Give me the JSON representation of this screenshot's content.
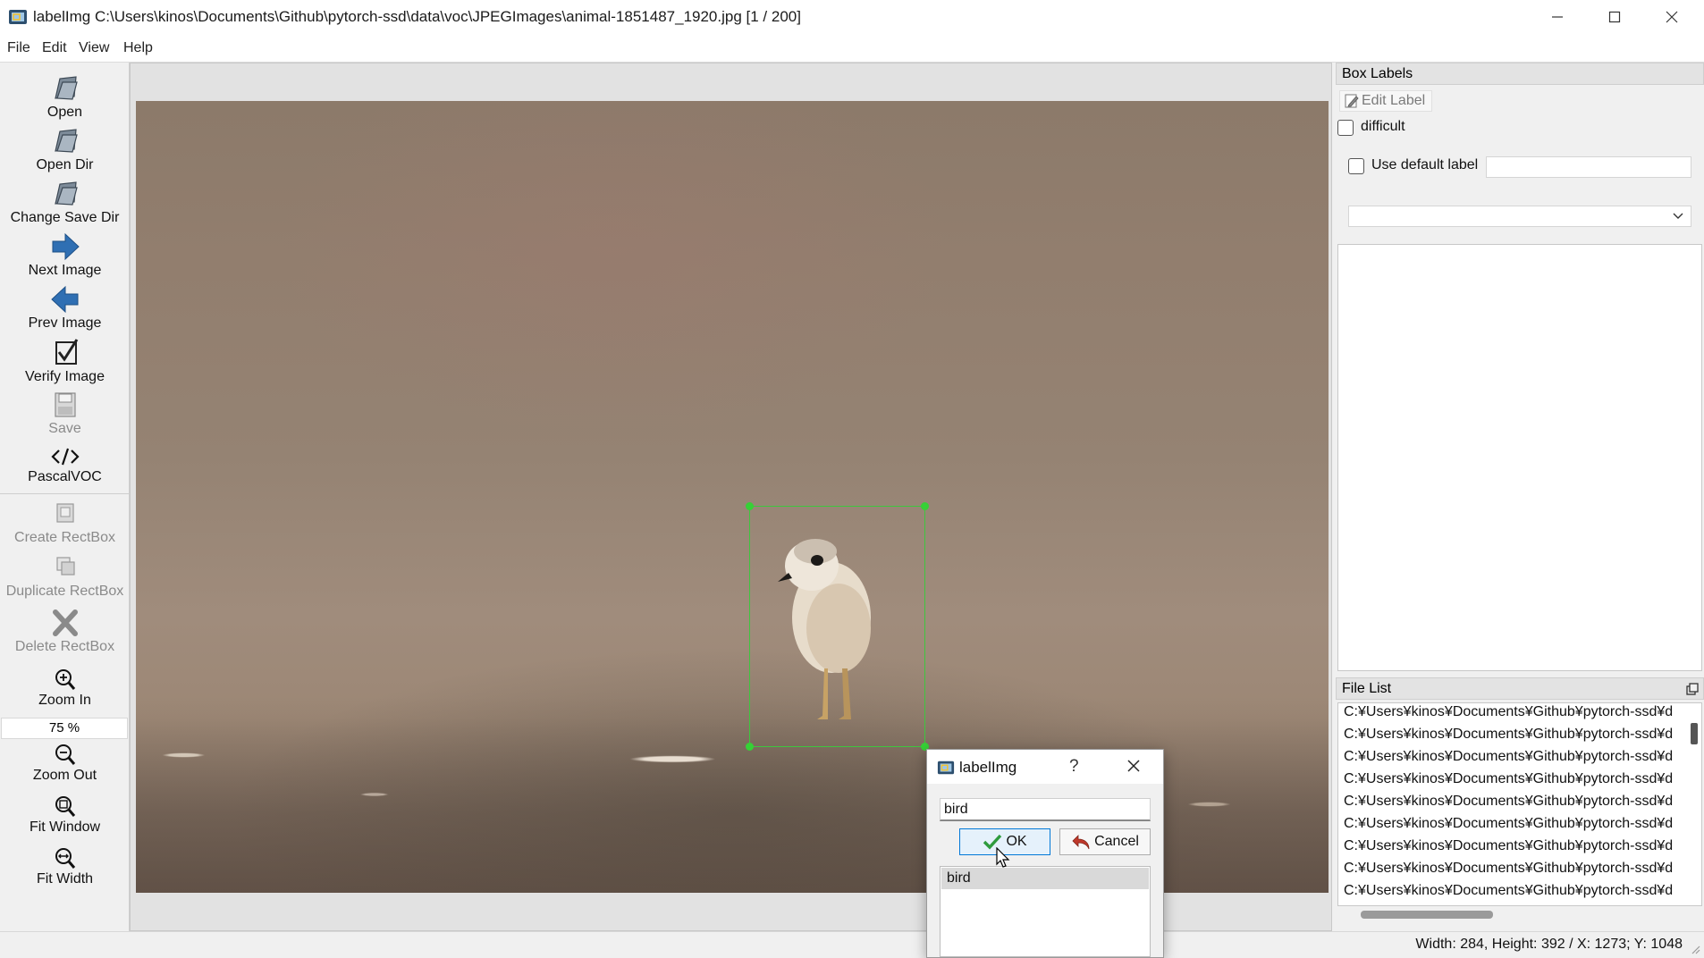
{
  "window": {
    "title": "labelImg C:\\Users\\kinos\\Documents\\Github\\pytorch-ssd\\data\\voc\\JPEGImages\\animal-1851487_1920.jpg [1 / 200]",
    "controls": [
      "minimize-icon",
      "maximize-icon",
      "close-icon"
    ]
  },
  "menu": {
    "file": "File",
    "edit": "Edit",
    "view": "View",
    "help": "Help"
  },
  "toolbar": {
    "open": "Open",
    "open_dir": "Open Dir",
    "change_save_dir": "Change Save Dir",
    "next_image": "Next Image",
    "prev_image": "Prev Image",
    "verify_image": "Verify Image",
    "save": "Save",
    "format": "PascalVOC",
    "create_rectbox": "Create RectBox",
    "duplicate_rectbox": "Duplicate RectBox",
    "delete_rectbox": "Delete RectBox",
    "zoom_in": "Zoom In",
    "zoom_value": "75 %",
    "zoom_out": "Zoom Out",
    "fit_window": "Fit Window",
    "fit_width": "Fit Width"
  },
  "box_labels": {
    "title": "Box Labels",
    "edit_label": "Edit Label",
    "difficult": "difficult",
    "use_default_label": "Use default label",
    "default_label_value": "",
    "combo_value": ""
  },
  "file_list": {
    "title": "File List",
    "items": [
      "C:¥Users¥kinos¥Documents¥Github¥pytorch-ssd¥d",
      "C:¥Users¥kinos¥Documents¥Github¥pytorch-ssd¥d",
      "C:¥Users¥kinos¥Documents¥Github¥pytorch-ssd¥d",
      "C:¥Users¥kinos¥Documents¥Github¥pytorch-ssd¥d",
      "C:¥Users¥kinos¥Documents¥Github¥pytorch-ssd¥d",
      "C:¥Users¥kinos¥Documents¥Github¥pytorch-ssd¥d",
      "C:¥Users¥kinos¥Documents¥Github¥pytorch-ssd¥d",
      "C:¥Users¥kinos¥Documents¥Github¥pytorch-ssd¥d",
      "C:¥Users¥kinos¥Documents¥Github¥pytorch-ssd¥d"
    ]
  },
  "status": {
    "text": "Width: 284, Height: 392 / X: 1273; Y: 1048"
  },
  "dialog": {
    "title": "labelImg",
    "help": "?",
    "input_value": "bird",
    "ok_label": "OK",
    "cancel_label": "Cancel",
    "list_items": [
      "bird"
    ]
  },
  "colors": {
    "bbox": "#3ec63e",
    "arrow_blue": "#2f6fb3",
    "ok_border": "#0078d7"
  }
}
